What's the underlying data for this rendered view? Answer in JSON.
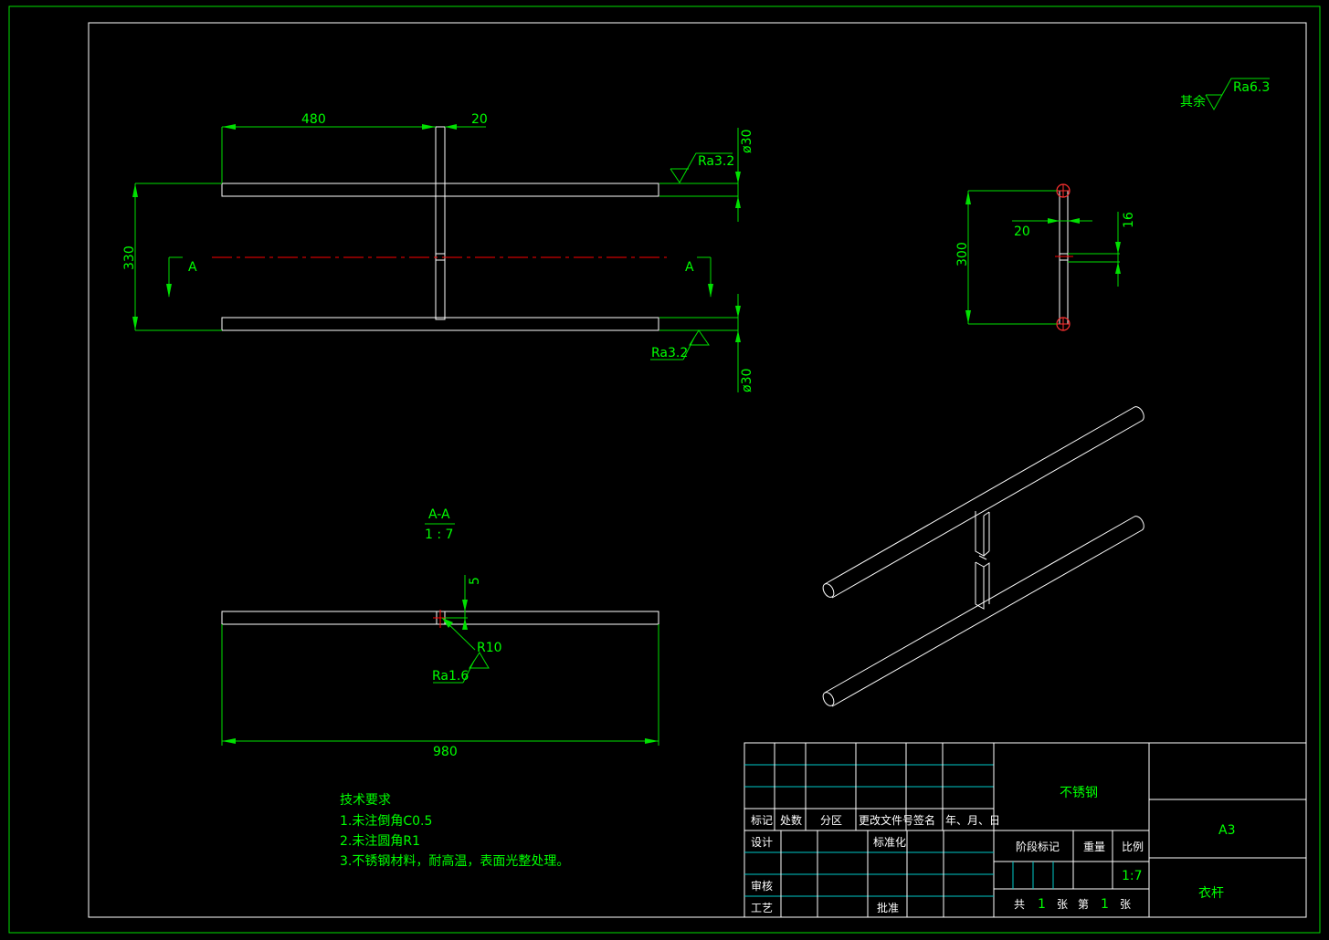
{
  "views": {
    "front": {
      "dim_length": "480",
      "dim_width": "20",
      "dim_height": "330",
      "dim_dia_top": "ø30",
      "dim_dia_bottom": "ø30",
      "rough_top": "Ra3.2",
      "rough_bottom": "Ra3.2",
      "section_mark_left": "A",
      "section_mark_right": "A"
    },
    "side": {
      "dim_height": "300",
      "dim_width": "20",
      "dim_small": "16"
    },
    "section": {
      "title": "A-A",
      "scale": "1 : 7",
      "dim_depth": "5",
      "dim_radius": "R10",
      "rough": "Ra1.6",
      "dim_length": "980"
    },
    "general_rough": {
      "label": "其余",
      "value": "Ra6.3"
    }
  },
  "tech_requirements": {
    "title": "技术要求",
    "items": [
      "1.未注倒角C0.5",
      "2.未注圆角R1",
      "3.不锈钢材料，耐高温，表面光整处理。"
    ]
  },
  "title_block": {
    "material": "不锈钢",
    "sheet_size": "A3",
    "part_name": "衣杆",
    "headers": [
      "标记",
      "处数",
      "分区",
      "更改文件号",
      "签名",
      "年、月、日"
    ],
    "design": "设计",
    "standardize": "标准化",
    "review": "审核",
    "process": "工艺",
    "approve": "批准",
    "stage_mark": "阶段标记",
    "weight": "重量",
    "scale": "比例",
    "scale_value": "1:7",
    "total_label": "共",
    "total_value": "1",
    "sheet_label": "张",
    "sheet_no_label": "第",
    "sheet_no_value": "1",
    "sheet_label2": "张"
  },
  "colors": {
    "background": "#000000",
    "frame": "#00e000",
    "part_line": "#ffffff",
    "center_line": "#ff0000",
    "table_line": "#00c8c8"
  }
}
